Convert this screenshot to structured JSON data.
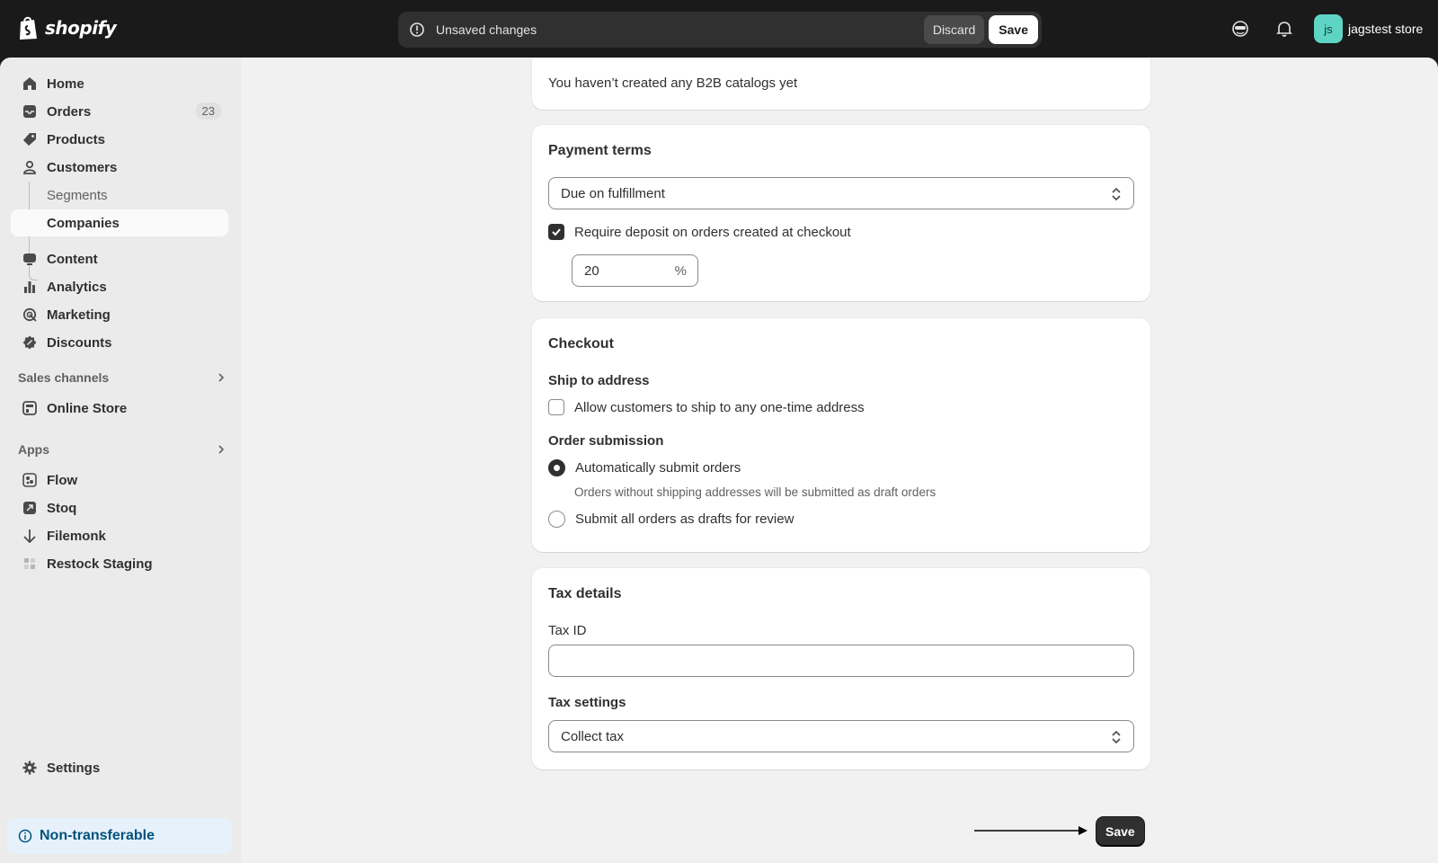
{
  "topbar": {
    "logo_text": "shopify",
    "unsaved_text": "Unsaved changes",
    "discard_label": "Discard",
    "save_label": "Save",
    "avatar_initials": "js",
    "store_name": "jagstest store"
  },
  "sidebar": {
    "home": "Home",
    "orders": "Orders",
    "orders_count": "23",
    "products": "Products",
    "customers": "Customers",
    "segments": "Segments",
    "companies": "Companies",
    "content": "Content",
    "analytics": "Analytics",
    "marketing": "Marketing",
    "discounts": "Discounts",
    "sales_channels": "Sales channels",
    "online_store": "Online Store",
    "apps": "Apps",
    "flow": "Flow",
    "stoq": "Stoq",
    "filemonk": "Filemonk",
    "restock": "Restock Staging",
    "settings": "Settings",
    "non_transferable": "Non-transferable"
  },
  "catalogs": {
    "empty_text": "You haven’t created any B2B catalogs yet"
  },
  "payment_terms": {
    "title": "Payment terms",
    "selected": "Due on fulfillment",
    "deposit_label": "Require deposit on orders created at checkout",
    "deposit_checked": true,
    "deposit_value": "20",
    "deposit_unit": "%"
  },
  "checkout": {
    "title": "Checkout",
    "ship_heading": "Ship to address",
    "ship_option": "Allow customers to ship to any one-time address",
    "ship_checked": false,
    "order_heading": "Order submission",
    "auto_submit": "Automatically submit orders",
    "auto_submit_helper": "Orders without shipping addresses will be submitted as draft orders",
    "drafts_option": "Submit all orders as drafts for review",
    "selected_option": "auto_submit"
  },
  "tax": {
    "title": "Tax details",
    "tax_id_label": "Tax ID",
    "tax_id_value": "",
    "settings_label": "Tax settings",
    "settings_selected": "Collect tax"
  },
  "footer": {
    "save_label": "Save"
  },
  "colors": {
    "topbar_bg": "#1a1a1a",
    "page_bg": "#f1f1f1",
    "sidebar_bg": "#ebebeb",
    "avatar_bg": "#5ed4c4",
    "primary_button": "#303030",
    "info_bg": "#e6f1fb"
  }
}
